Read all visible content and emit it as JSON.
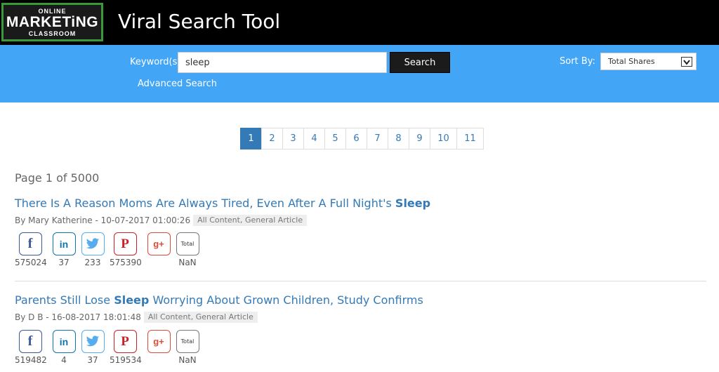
{
  "logo": {
    "line1": "ONLINE",
    "line2": "MARKETiNG",
    "line3": "CLASSROOM"
  },
  "header": {
    "title": "Viral Search Tool"
  },
  "search": {
    "keyword_label": "Keyword(s)",
    "keyword_value": "sleep",
    "button_label": "Search",
    "advanced_link": "Advanced Search",
    "sort_label": "Sort By:",
    "sort_value": "Total Shares"
  },
  "pagination": {
    "pages": [
      "1",
      "2",
      "3",
      "4",
      "5",
      "6",
      "7",
      "8",
      "9",
      "10",
      "11"
    ],
    "active": "1"
  },
  "page_count": "Page 1 of 5000",
  "colors": {
    "header_bg": "#000000",
    "search_bar_bg": "#42a5f5",
    "link": "#337ab7"
  },
  "results": [
    {
      "title_pre": "There Is A Reason Moms Are Always Tired, Even After A Full Night's ",
      "title_bold": "Sleep",
      "title_post": "",
      "meta": "By Mary Katherine - 10-07-2017 01:00:26",
      "tag": "All Content, General Article",
      "shares": {
        "facebook": "575024",
        "linkedin": "37",
        "twitter": "233",
        "pinterest": "575390",
        "googleplus": "",
        "total": "NaN",
        "total_label": "Total"
      }
    },
    {
      "title_pre": "Parents Still Lose ",
      "title_bold": "Sleep",
      "title_post": " Worrying About Grown Children, Study Confirms",
      "meta": "By D B - 16-08-2017 18:01:48",
      "tag": "All Content, General Article",
      "shares": {
        "facebook": "519482",
        "linkedin": "4",
        "twitter": "37",
        "pinterest": "519534",
        "googleplus": "",
        "total": "NaN",
        "total_label": "Total"
      }
    }
  ]
}
